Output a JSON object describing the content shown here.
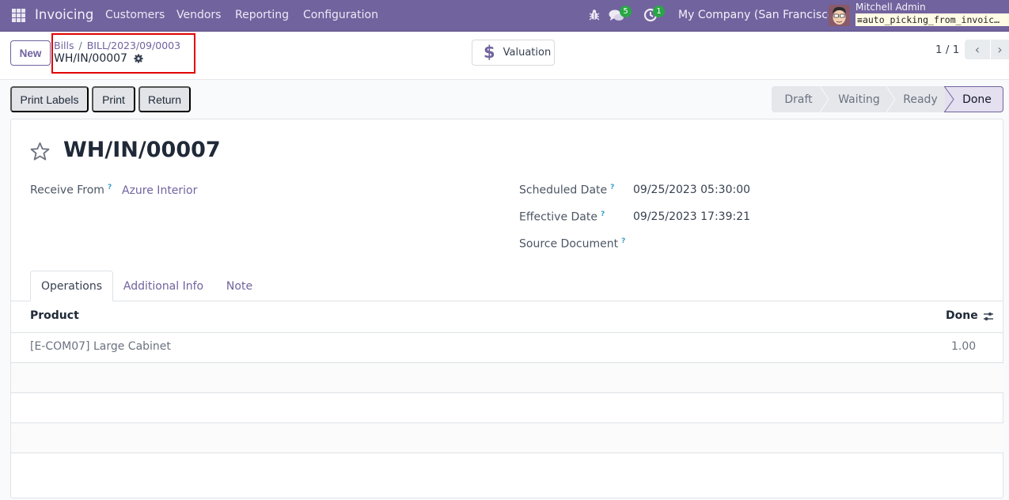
{
  "navbar": {
    "app_name": "Invoicing",
    "menu": [
      "Customers",
      "Vendors",
      "Reporting",
      "Configuration"
    ],
    "messages_count": "5",
    "activities_count": "1",
    "company": "My Company (San Francisco)",
    "user_name": "Mitchell Admin",
    "database": "auto_picking_from_invoic…",
    "colors": {
      "brand": "#71639e",
      "badge": "#28a745"
    }
  },
  "control_panel": {
    "new_label": "New",
    "breadcrumb": [
      "Bills",
      "BILL/2023/09/0003"
    ],
    "current_record": "WH/IN/00007",
    "valuation_label": "Valuation",
    "pager": "1 / 1"
  },
  "statusbar": {
    "buttons": [
      "Print Labels",
      "Print",
      "Return"
    ],
    "stages": [
      "Draft",
      "Waiting",
      "Ready",
      "Done"
    ],
    "current_stage": "Done"
  },
  "form": {
    "title": "WH/IN/00007",
    "receive_from_label": "Receive From",
    "receive_from_value": "Azure Interior",
    "scheduled_date_label": "Scheduled Date",
    "scheduled_date_value": "09/25/2023 05:30:00",
    "effective_date_label": "Effective Date",
    "effective_date_value": "09/25/2023 17:39:21",
    "source_document_label": "Source Document",
    "source_document_value": "",
    "help_mark": "?"
  },
  "tabs": [
    "Operations",
    "Additional Info",
    "Note"
  ],
  "active_tab": "Operations",
  "operations": {
    "columns": [
      "Product",
      "Done"
    ],
    "rows": [
      {
        "product": "[E-COM07] Large Cabinet",
        "done": "1.00"
      }
    ]
  }
}
